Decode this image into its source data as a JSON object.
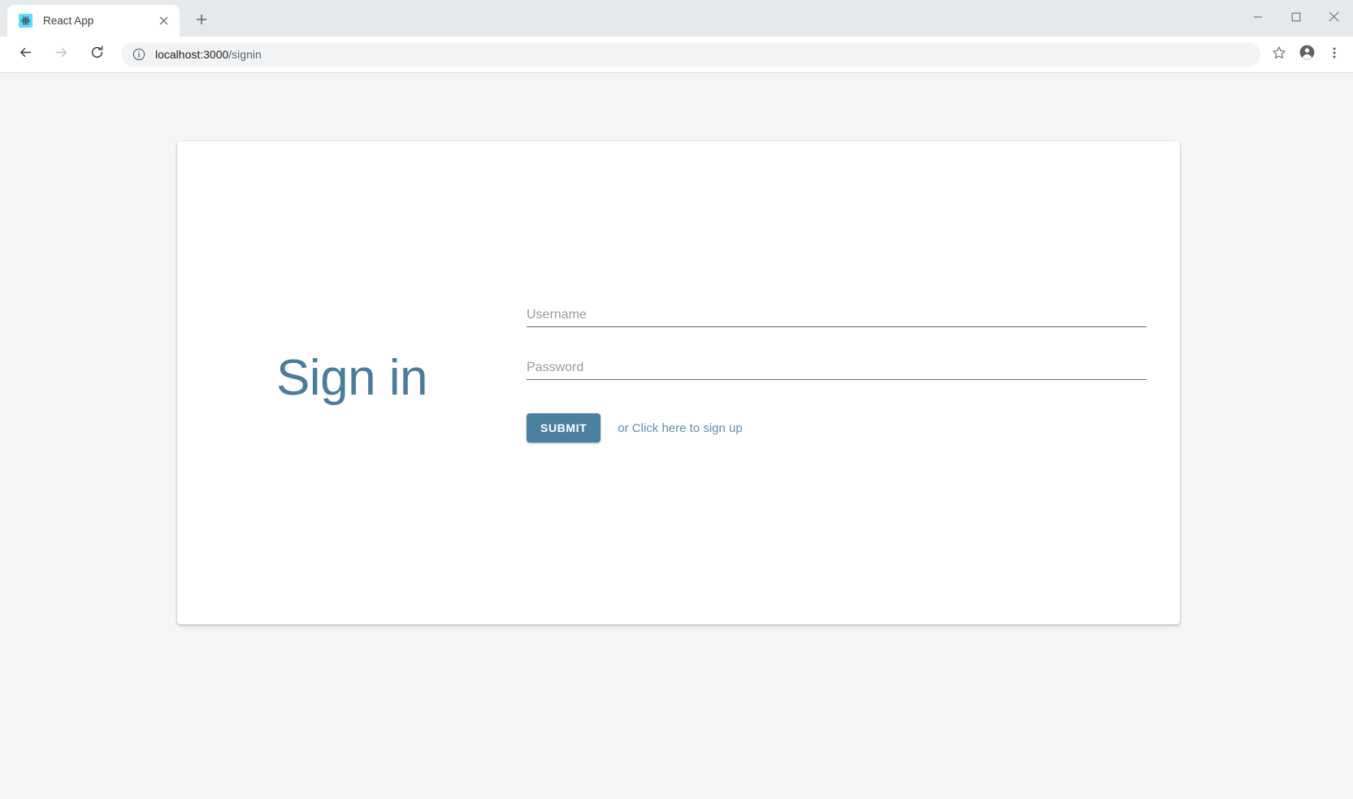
{
  "browser": {
    "tab": {
      "title": "React App",
      "favicon_icon": "react-logo-icon",
      "close_icon": "close-icon"
    },
    "new_tab_icon": "plus-icon",
    "window_controls": {
      "minimize_icon": "minimize-icon",
      "maximize_icon": "maximize-icon",
      "close_icon": "close-icon"
    },
    "toolbar": {
      "back_icon": "arrow-left-icon",
      "forward_icon": "arrow-right-icon",
      "reload_icon": "reload-icon",
      "site_info_icon": "info-circle-icon",
      "url_host": "localhost:3000",
      "url_path": "/signin",
      "url_full": "localhost:3000/signin",
      "bookmark_icon": "star-outline-icon",
      "profile_icon": "account-circle-icon",
      "menu_icon": "more-vertical-icon"
    }
  },
  "page": {
    "heading": "Sign in",
    "fields": [
      {
        "name": "username",
        "label": "Username",
        "value": "",
        "type": "text"
      },
      {
        "name": "password",
        "label": "Password",
        "value": "",
        "type": "password"
      }
    ],
    "submit_label": "SUBMIT",
    "signup_prefix": "or ",
    "signup_link_label": "Click here to sign up"
  },
  "colors": {
    "accent": "#4a7d9b",
    "button": "#4a80a0",
    "link": "#5f8fad",
    "page_background": "#f5f5f5",
    "card_background": "#ffffff",
    "label_text": "#9a9a9a",
    "field_underline": "#6b6b6b"
  }
}
